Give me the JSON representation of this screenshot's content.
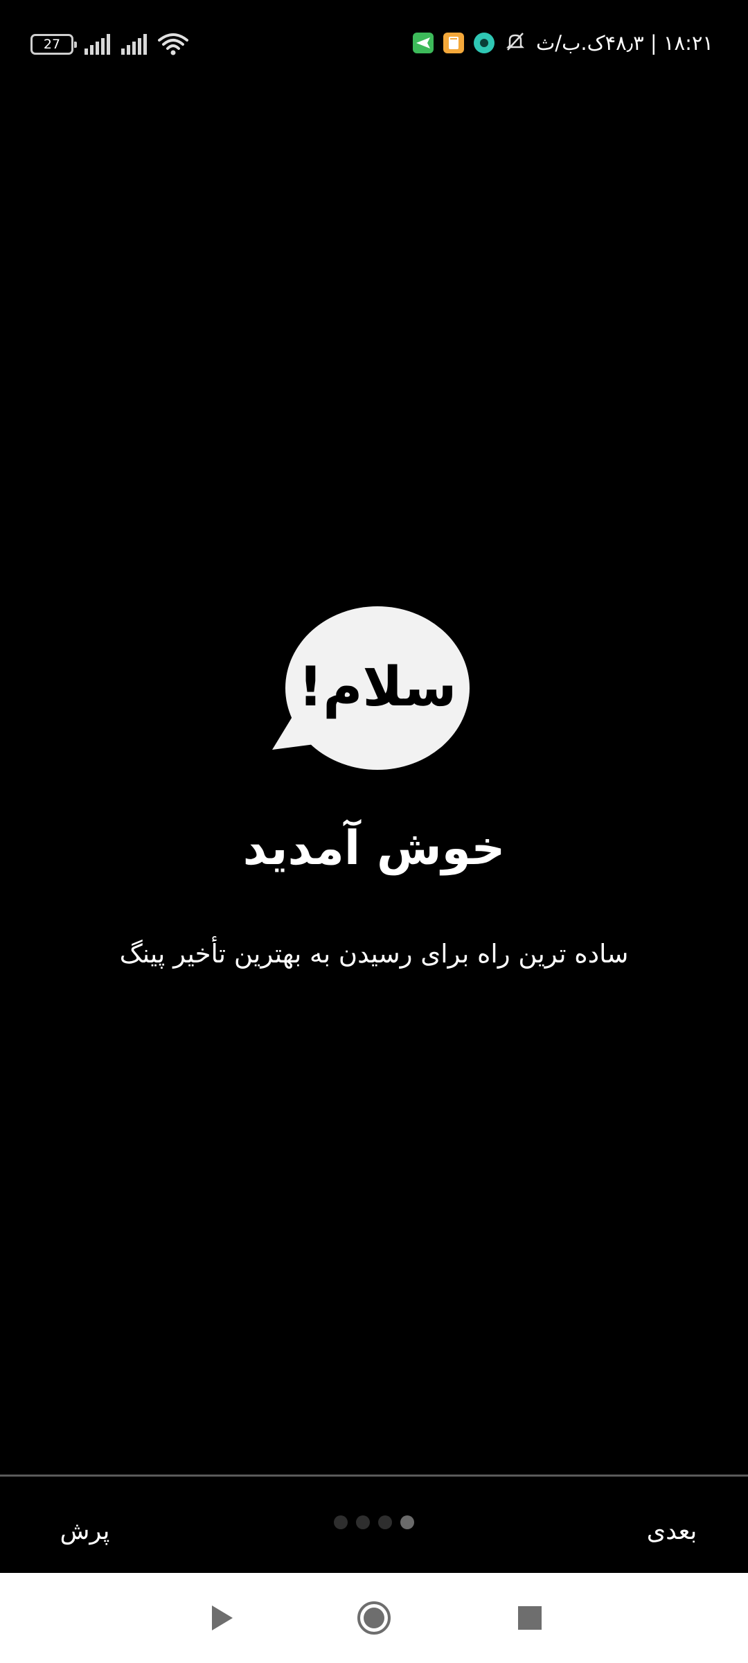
{
  "status_bar": {
    "battery_level": "27",
    "time_and_speed": "۱۸:۲۱ | ۴۸٫۳ک.ب/ث",
    "icons": [
      "battery-icon",
      "signal-icon",
      "signal-icon",
      "wifi-icon",
      "send-app-icon",
      "note-app-icon",
      "chat-app-icon",
      "mute-icon"
    ],
    "colors": {
      "send_app": "#3dba5a",
      "note_app": "#f4a83a",
      "chat_app": "#2fc7b4"
    }
  },
  "logo": {
    "text": "سلام!",
    "bubble_color": "#f2f2f2",
    "text_color": "#000000"
  },
  "welcome": {
    "title": "خوش آمدید",
    "subtitle": "ساده ترین راه برای رسیدن به بهترین تأخیر پینگ"
  },
  "onboarding": {
    "skip_label": "پرش",
    "next_label": "بعدی",
    "total_pages": 4,
    "current_page": 4
  },
  "nav_bar": {
    "icons": [
      "back-icon",
      "home-icon",
      "recents-icon"
    ]
  }
}
